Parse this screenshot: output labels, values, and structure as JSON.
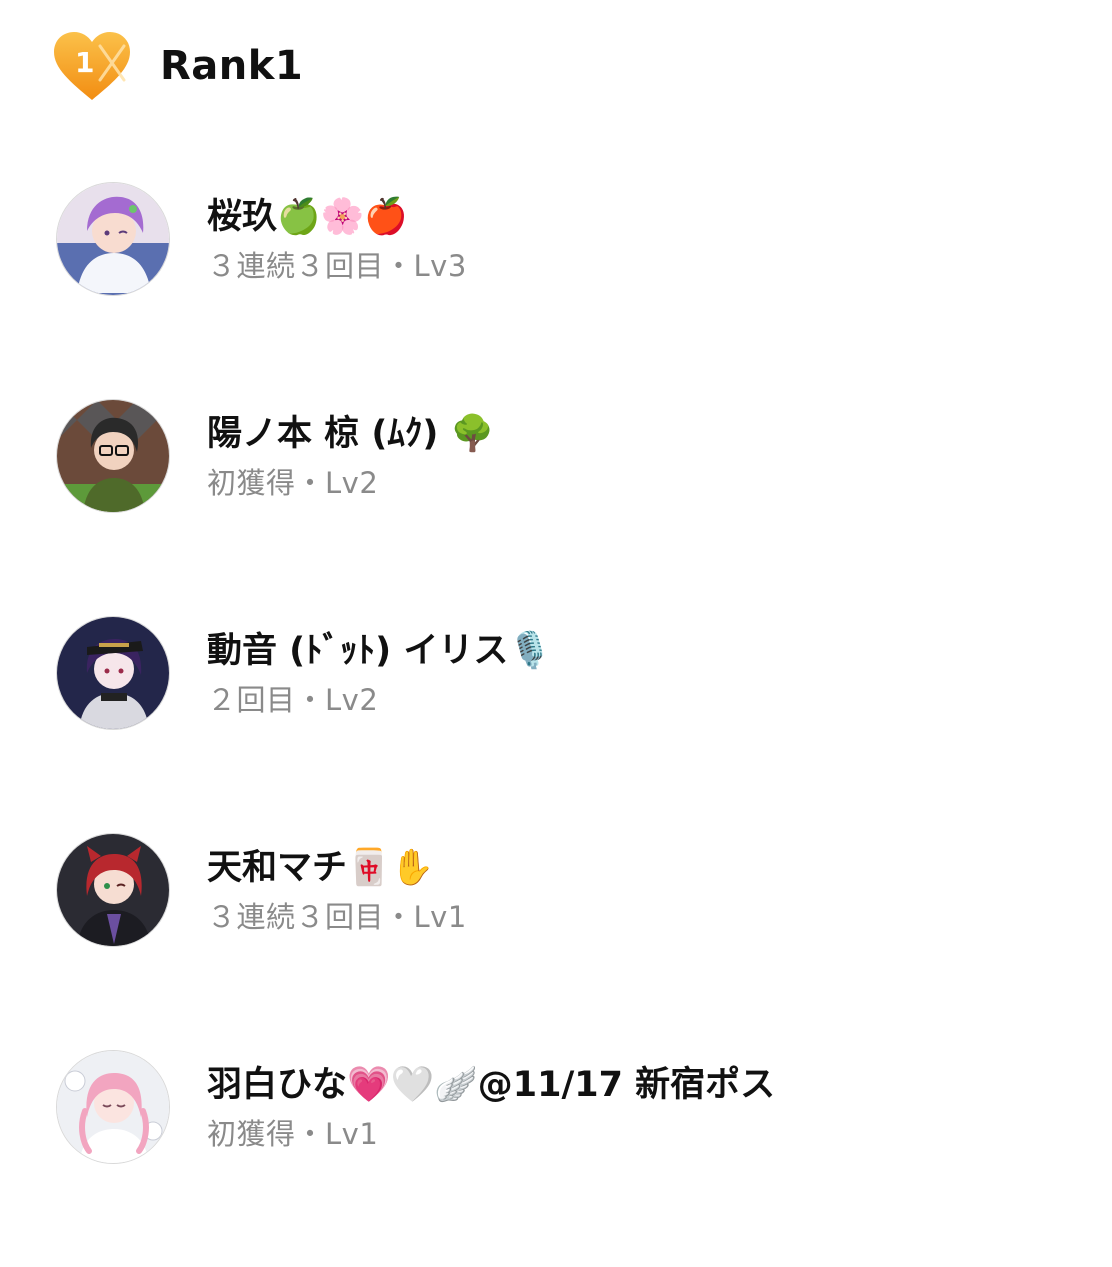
{
  "header": {
    "badge_number": "1",
    "title": "Rank1"
  },
  "colors": {
    "badge_orange": "#f6a21c",
    "text_primary": "#111111",
    "text_secondary": "#8a8a8a"
  },
  "entries": [
    {
      "name": "桜玖🍏🌸🍎",
      "status": "３連続３回目・Lv3",
      "avatar_icon": "avatar-purple-hair"
    },
    {
      "name": "陽ノ本 椋 (ﾑｸ) 🌳",
      "status": "初獲得・Lv2",
      "avatar_icon": "avatar-glasses"
    },
    {
      "name": "動音 (ﾄﾞｯﾄ) イリス🎙️",
      "status": "２回目・Lv2",
      "avatar_icon": "avatar-dark-hair-cap"
    },
    {
      "name": "天和マチ🀄✋",
      "status": "３連続３回目・Lv1",
      "avatar_icon": "avatar-red-hair"
    },
    {
      "name": "羽白ひな💗🤍🪽@11/17 新宿ポス",
      "status": "初獲得・Lv1",
      "avatar_icon": "avatar-pink-hair"
    }
  ]
}
